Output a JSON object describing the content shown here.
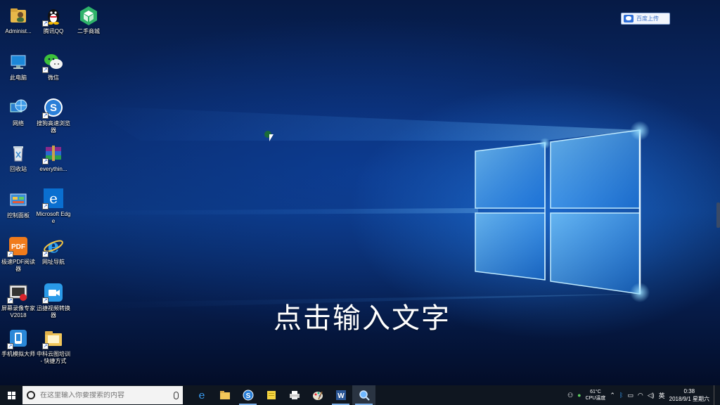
{
  "desktop": {
    "icons": [
      {
        "label": "Administ...",
        "icon": "user-folder-icon"
      },
      {
        "label": "腾讯QQ",
        "icon": "qq-penguin-icon"
      },
      {
        "label": "二手商城",
        "icon": "green-cube-icon"
      },
      {
        "label": "此电脑",
        "icon": "computer-icon"
      },
      {
        "label": "微信",
        "icon": "wechat-icon"
      },
      {
        "label": "网络",
        "icon": "network-globe-icon"
      },
      {
        "label": "搜狗高速浏览器",
        "icon": "sogou-browser-icon"
      },
      {
        "label": "回收站",
        "icon": "recycle-bin-icon"
      },
      {
        "label": "everythin...",
        "icon": "winrar-books-icon"
      },
      {
        "label": "控制面板",
        "icon": "control-panel-icon"
      },
      {
        "label": "Microsoft Edge",
        "icon": "edge-icon"
      },
      {
        "label": "极速PDF阅读器",
        "icon": "pdf-reader-icon"
      },
      {
        "label": "网址导航",
        "icon": "ie-icon"
      },
      {
        "label": "屏幕录像专家 V2018",
        "icon": "screen-recorder-icon"
      },
      {
        "label": "迅捷视频转换器",
        "icon": "video-converter-icon"
      },
      {
        "label": "手机模拟大师",
        "icon": "phone-emulator-icon"
      },
      {
        "label": "中科云图培训 - 快捷方式",
        "icon": "folder-icon"
      }
    ]
  },
  "cloud_button": {
    "label": "百度上传"
  },
  "caption": "点击输入文字",
  "taskbar": {
    "search_placeholder": "在这里输入你要搜索的内容",
    "apps": [
      "edge-icon",
      "file-explorer-icon",
      "sogou-browser-icon",
      "sticky-notes-icon",
      "printer-icon",
      "paint-icon",
      "word-icon",
      "magnifier-icon"
    ],
    "tray": {
      "temperature": "61°C",
      "cpu_label": "CPU温度",
      "input_method": "英",
      "time": "0:38",
      "date": "2018/9/1 星期六"
    }
  },
  "colors": {
    "taskbar_bg": "#0f1620",
    "accent": "#7fb2ea",
    "wallpaper_light": "#3aa0ff"
  }
}
